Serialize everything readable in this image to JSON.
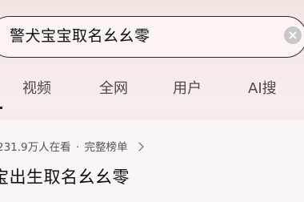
{
  "search": {
    "query": "警犬宝宝取名幺幺零"
  },
  "tabs": [
    {
      "label": "视频"
    },
    {
      "label": "全网"
    },
    {
      "label": "用户"
    },
    {
      "label": "AI搜"
    }
  ],
  "hot": {
    "viewers": "231.9万人在看",
    "separator": "·",
    "rank_link": "完整榜单"
  },
  "result": {
    "title": "宝出生取名幺幺零"
  },
  "icons": {
    "clear": "close-circle-icon",
    "chevron": "chevron-right-icon"
  }
}
